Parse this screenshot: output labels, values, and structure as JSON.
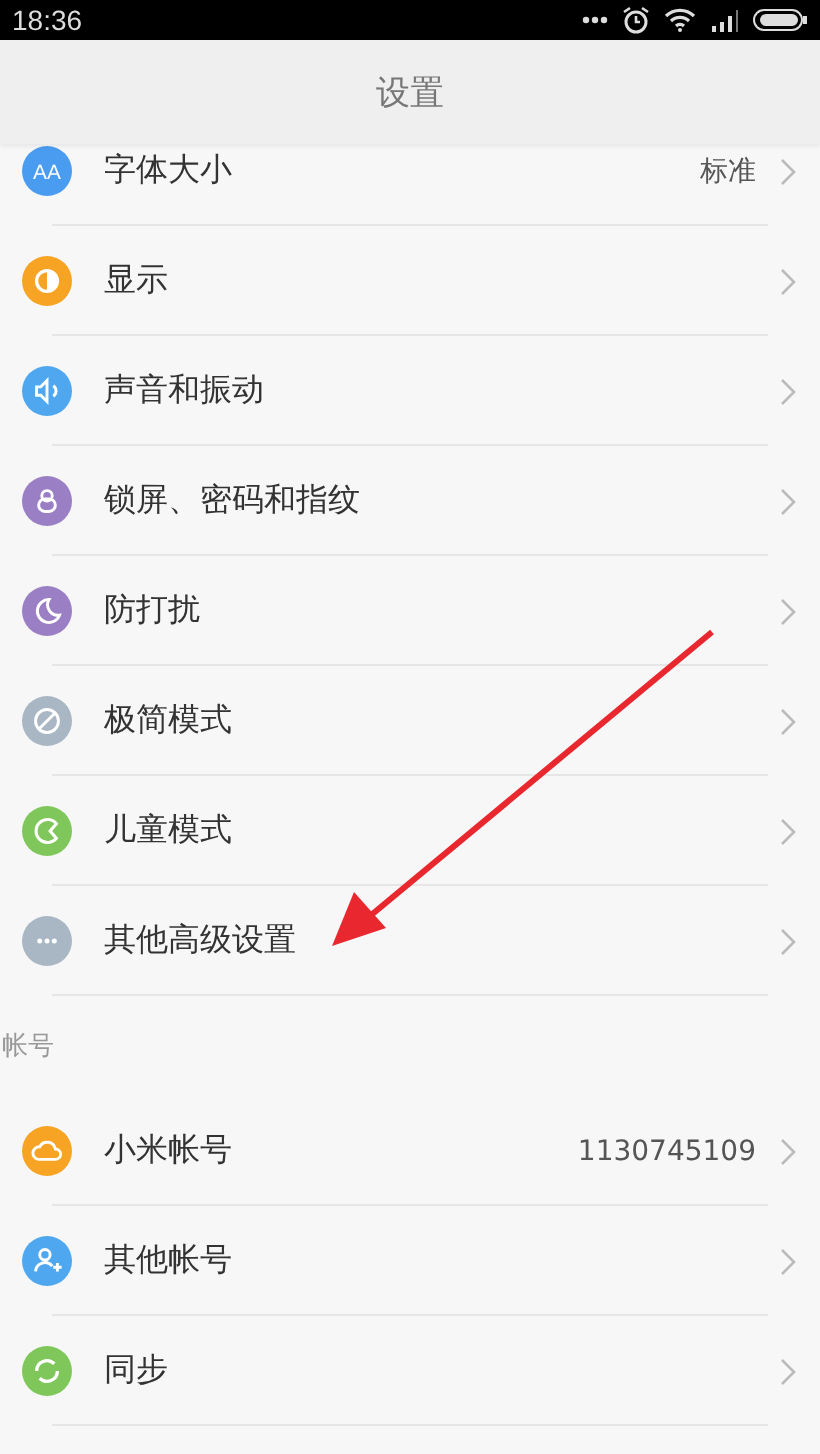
{
  "status_bar": {
    "time": "18:36"
  },
  "header": {
    "title": "设置"
  },
  "sections": [
    {
      "items": [
        {
          "label": "字体大小",
          "value": "标准",
          "color": "#4a9cf0",
          "icon_text": "AA"
        },
        {
          "label": "显示",
          "color": "#f7a425"
        },
        {
          "label": "声音和振动",
          "color": "#4fa8ef"
        },
        {
          "label": "锁屏、密码和指纹",
          "color": "#9b7fc4"
        },
        {
          "label": "防打扰",
          "color": "#9b7fc4"
        },
        {
          "label": "极简模式",
          "color": "#a9b6c3"
        },
        {
          "label": "儿童模式",
          "color": "#7fc75a"
        },
        {
          "label": "其他高级设置",
          "color": "#a9b6c3"
        }
      ]
    },
    {
      "title": "帐号",
      "items": [
        {
          "label": "小米帐号",
          "value": "1130745109",
          "color": "#f7a425"
        },
        {
          "label": "其他帐号",
          "color": "#4fa8ef"
        },
        {
          "label": "同步",
          "color": "#7fc75a"
        }
      ]
    }
  ]
}
